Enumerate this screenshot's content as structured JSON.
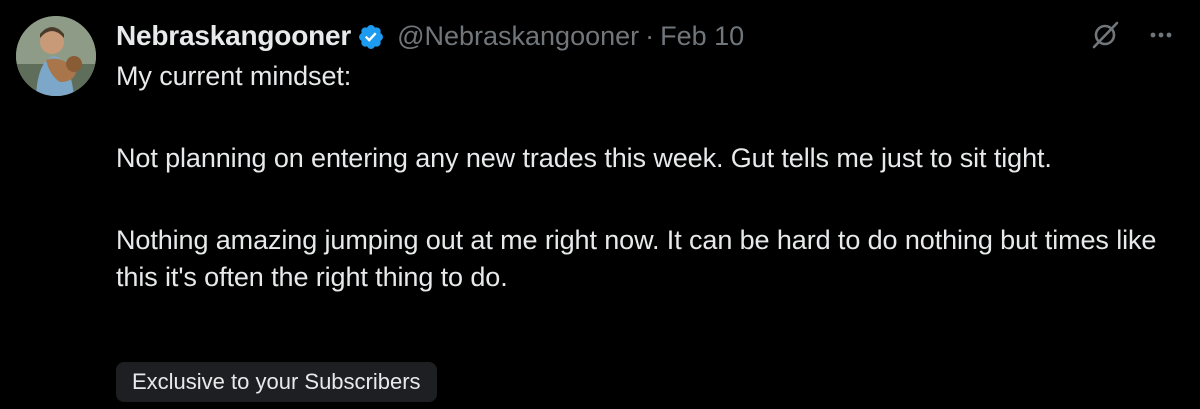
{
  "author": {
    "display_name": "Nebraskangooner",
    "handle": "@Nebraskangooner",
    "separator": "·",
    "date": "Feb 10",
    "verified": true
  },
  "tweet": {
    "line_1": "My current mindset:",
    "paragraph_2": "Not planning on entering any new trades this week. Gut tells me just to sit tight.",
    "paragraph_3": "Nothing amazing jumping out at me right now. It can be hard to do nothing but times like this it's often the right thing to do."
  },
  "badge": {
    "label": "Exclusive to your Subscribers"
  },
  "icons": {
    "verified": "verified-badge-icon",
    "grok": "grok-icon",
    "more": "more-options-icon"
  },
  "colors": {
    "background": "#000000",
    "text_primary": "#e7e9ea",
    "text_secondary": "#71767b",
    "verified_blue": "#1d9bf0",
    "badge_background": "#1d1f23"
  }
}
